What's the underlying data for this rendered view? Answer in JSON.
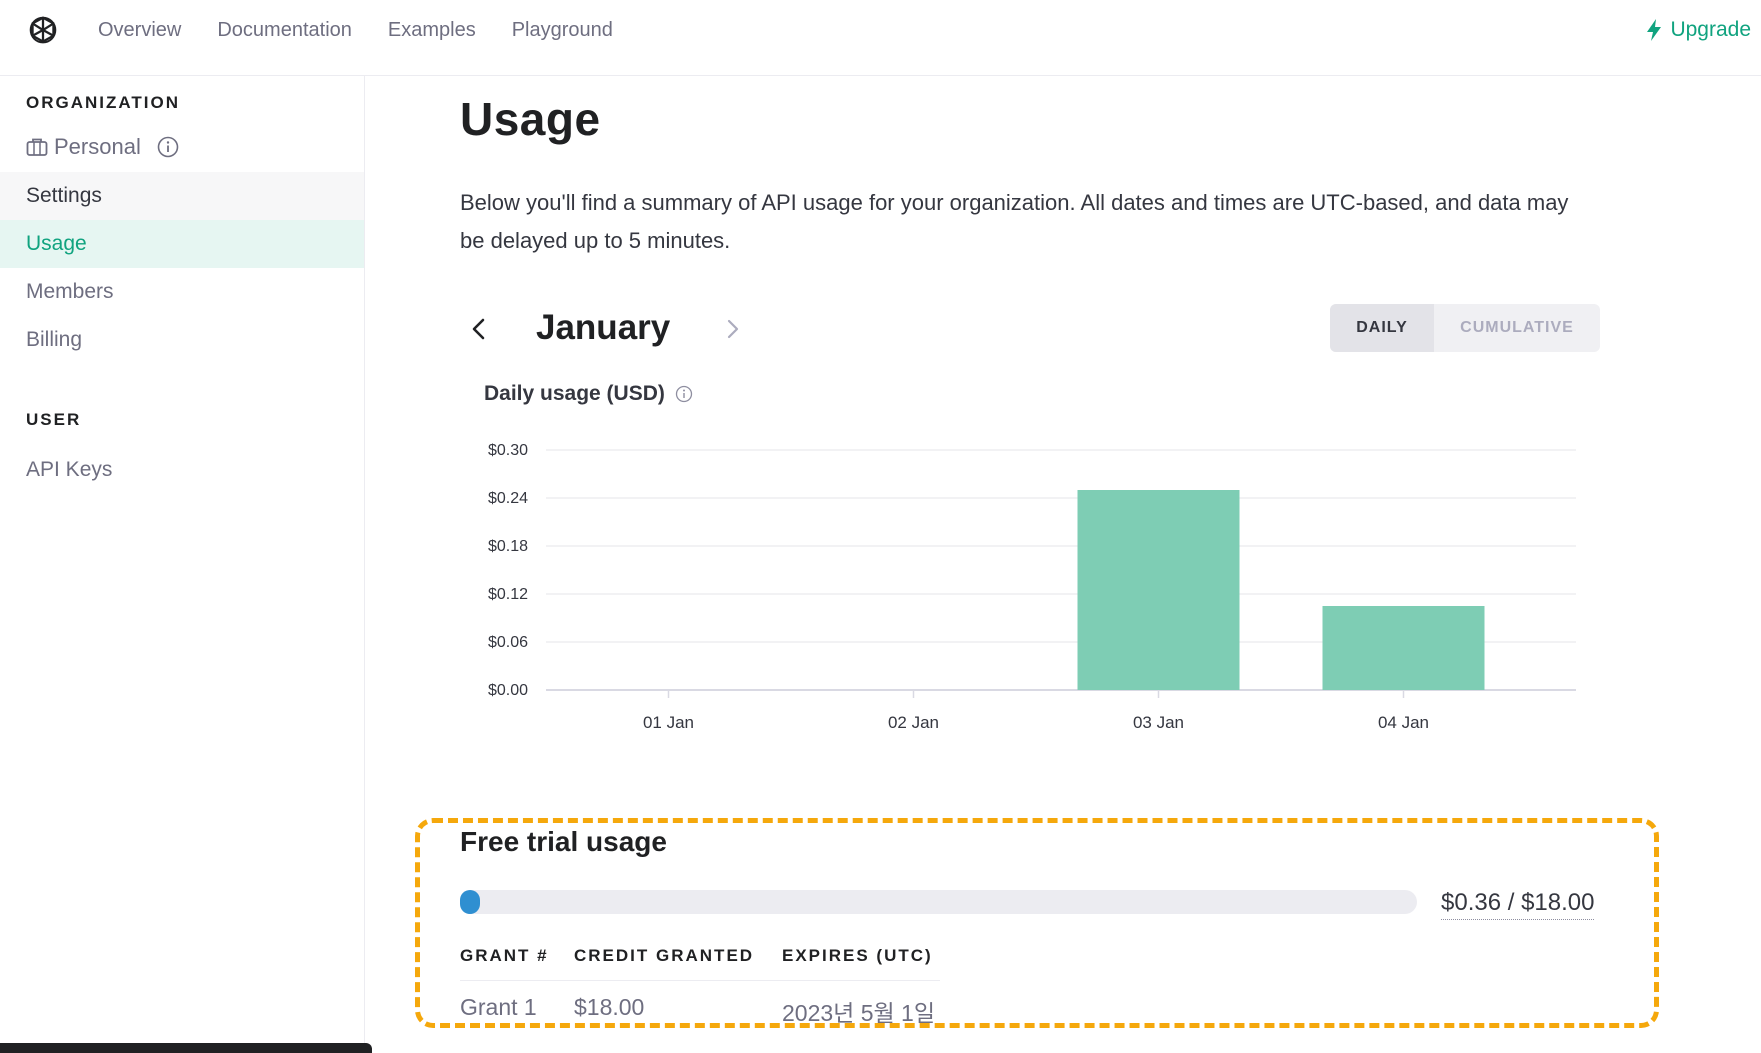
{
  "nav": {
    "items": [
      "Overview",
      "Documentation",
      "Examples",
      "Playground"
    ],
    "upgrade_label": "Upgrade"
  },
  "sidebar": {
    "org_heading": "ORGANIZATION",
    "org_name": "Personal",
    "items": [
      "Settings",
      "Usage",
      "Members",
      "Billing"
    ],
    "user_heading": "USER",
    "user_items": [
      "API Keys"
    ]
  },
  "main": {
    "title": "Usage",
    "intro": "Below you'll find a summary of API usage for your organization. All dates and times are UTC-based, and data may be delayed up to 5 minutes.",
    "month": "January",
    "toggle": {
      "daily": "DAILY",
      "cumulative": "CUMULATIVE",
      "selected": "DAILY"
    },
    "chart_title": "Daily usage (USD)"
  },
  "chart_data": {
    "type": "bar",
    "categories": [
      "01 Jan",
      "02 Jan",
      "03 Jan",
      "04 Jan"
    ],
    "values": [
      0,
      0,
      0.25,
      0.105
    ],
    "ylim": [
      0,
      0.3
    ],
    "yticks": [
      "$0.00",
      "$0.06",
      "$0.12",
      "$0.18",
      "$0.24",
      "$0.30"
    ],
    "ytick_values": [
      0,
      0.06,
      0.12,
      0.18,
      0.24,
      0.3
    ],
    "grid": true,
    "bar_color": "#7ecdb4"
  },
  "free_trial": {
    "title": "Free trial usage",
    "used": 0.36,
    "total": 18.0,
    "amount_label": "$0.36 / $18.00",
    "columns": [
      "GRANT #",
      "CREDIT GRANTED",
      "EXPIRES (UTC)"
    ],
    "rows": [
      {
        "grant": "Grant 1",
        "credit": "$18.00",
        "expires": "2023년 5월 1일"
      }
    ]
  },
  "colors": {
    "accent": "#10a37f",
    "highlight_border": "#f5a80c",
    "progress": "#2f8fd1"
  }
}
